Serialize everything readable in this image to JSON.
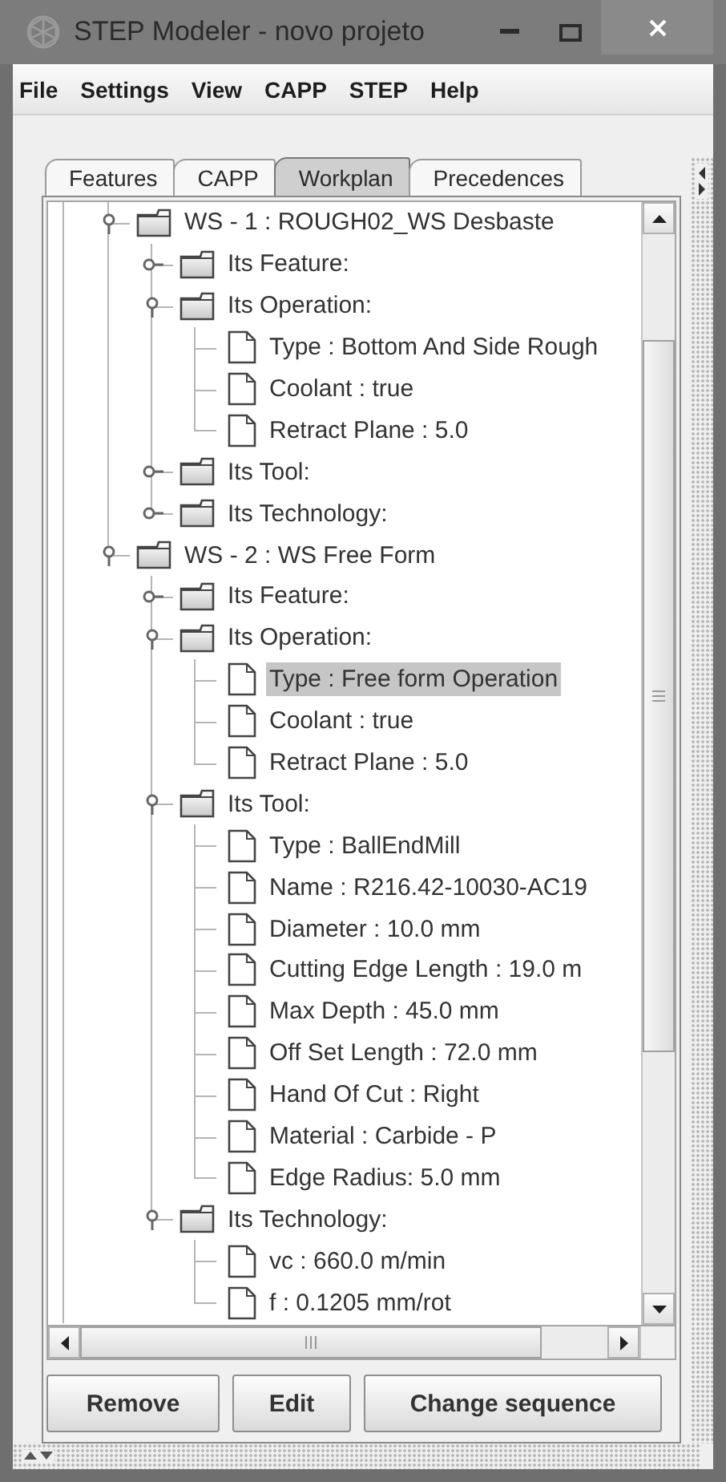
{
  "window": {
    "title": "STEP Modeler - novo projeto"
  },
  "menu": [
    "File",
    "Settings",
    "View",
    "CAPP",
    "STEP",
    "Help"
  ],
  "tabs": [
    {
      "label": "Features",
      "selected": false
    },
    {
      "label": "CAPP",
      "selected": false
    },
    {
      "label": "Workplan",
      "selected": true
    },
    {
      "label": "Precedences",
      "selected": false
    }
  ],
  "tree": [
    {
      "label": "WS - 1 : ROUGH02_WS Desbaste",
      "expanded": true,
      "selected": false,
      "children": [
        {
          "label": "Its Feature:",
          "expanded": false,
          "selected": false
        },
        {
          "label": "Its Operation:",
          "expanded": true,
          "selected": false,
          "children": [
            {
              "label": "Type : Bottom And Side Rough",
              "selected": false
            },
            {
              "label": "Coolant : true",
              "selected": false
            },
            {
              "label": "Retract Plane : 5.0",
              "selected": false
            }
          ]
        },
        {
          "label": "Its Tool:",
          "expanded": false,
          "selected": false
        },
        {
          "label": "Its Technology:",
          "expanded": false,
          "selected": false
        }
      ]
    },
    {
      "label": "WS - 2  : WS Free Form",
      "expanded": true,
      "selected": false,
      "children": [
        {
          "label": "Its Feature:",
          "expanded": false,
          "selected": false
        },
        {
          "label": "Its Operation:",
          "expanded": true,
          "selected": false,
          "children": [
            {
              "label": "Type : Free form Operation",
              "selected": true
            },
            {
              "label": "Coolant : true",
              "selected": false
            },
            {
              "label": "Retract Plane : 5.0",
              "selected": false
            }
          ]
        },
        {
          "label": "Its Tool:",
          "expanded": true,
          "selected": false,
          "children": [
            {
              "label": "Type : BallEndMill",
              "selected": false
            },
            {
              "label": "Name : R216.42-10030-AC19",
              "selected": false
            },
            {
              "label": "Diameter : 10.0 mm",
              "selected": false
            },
            {
              "label": "Cutting Edge Length : 19.0 m",
              "selected": false
            },
            {
              "label": "Max Depth : 45.0 mm",
              "selected": false
            },
            {
              "label": "Off Set Length : 72.0 mm",
              "selected": false
            },
            {
              "label": "Hand Of Cut : Right",
              "selected": false
            },
            {
              "label": "Material : Carbide - P",
              "selected": false
            },
            {
              "label": "Edge Radius: 5.0 mm",
              "selected": false
            }
          ]
        },
        {
          "label": "Its Technology:",
          "expanded": true,
          "selected": false,
          "children": [
            {
              "label": "vc : 660.0 m/min",
              "selected": false
            },
            {
              "label": "f : 0.1205 mm/rot",
              "selected": false
            }
          ]
        }
      ]
    }
  ],
  "buttons": [
    "Remove",
    "Edit",
    "Change sequence"
  ]
}
